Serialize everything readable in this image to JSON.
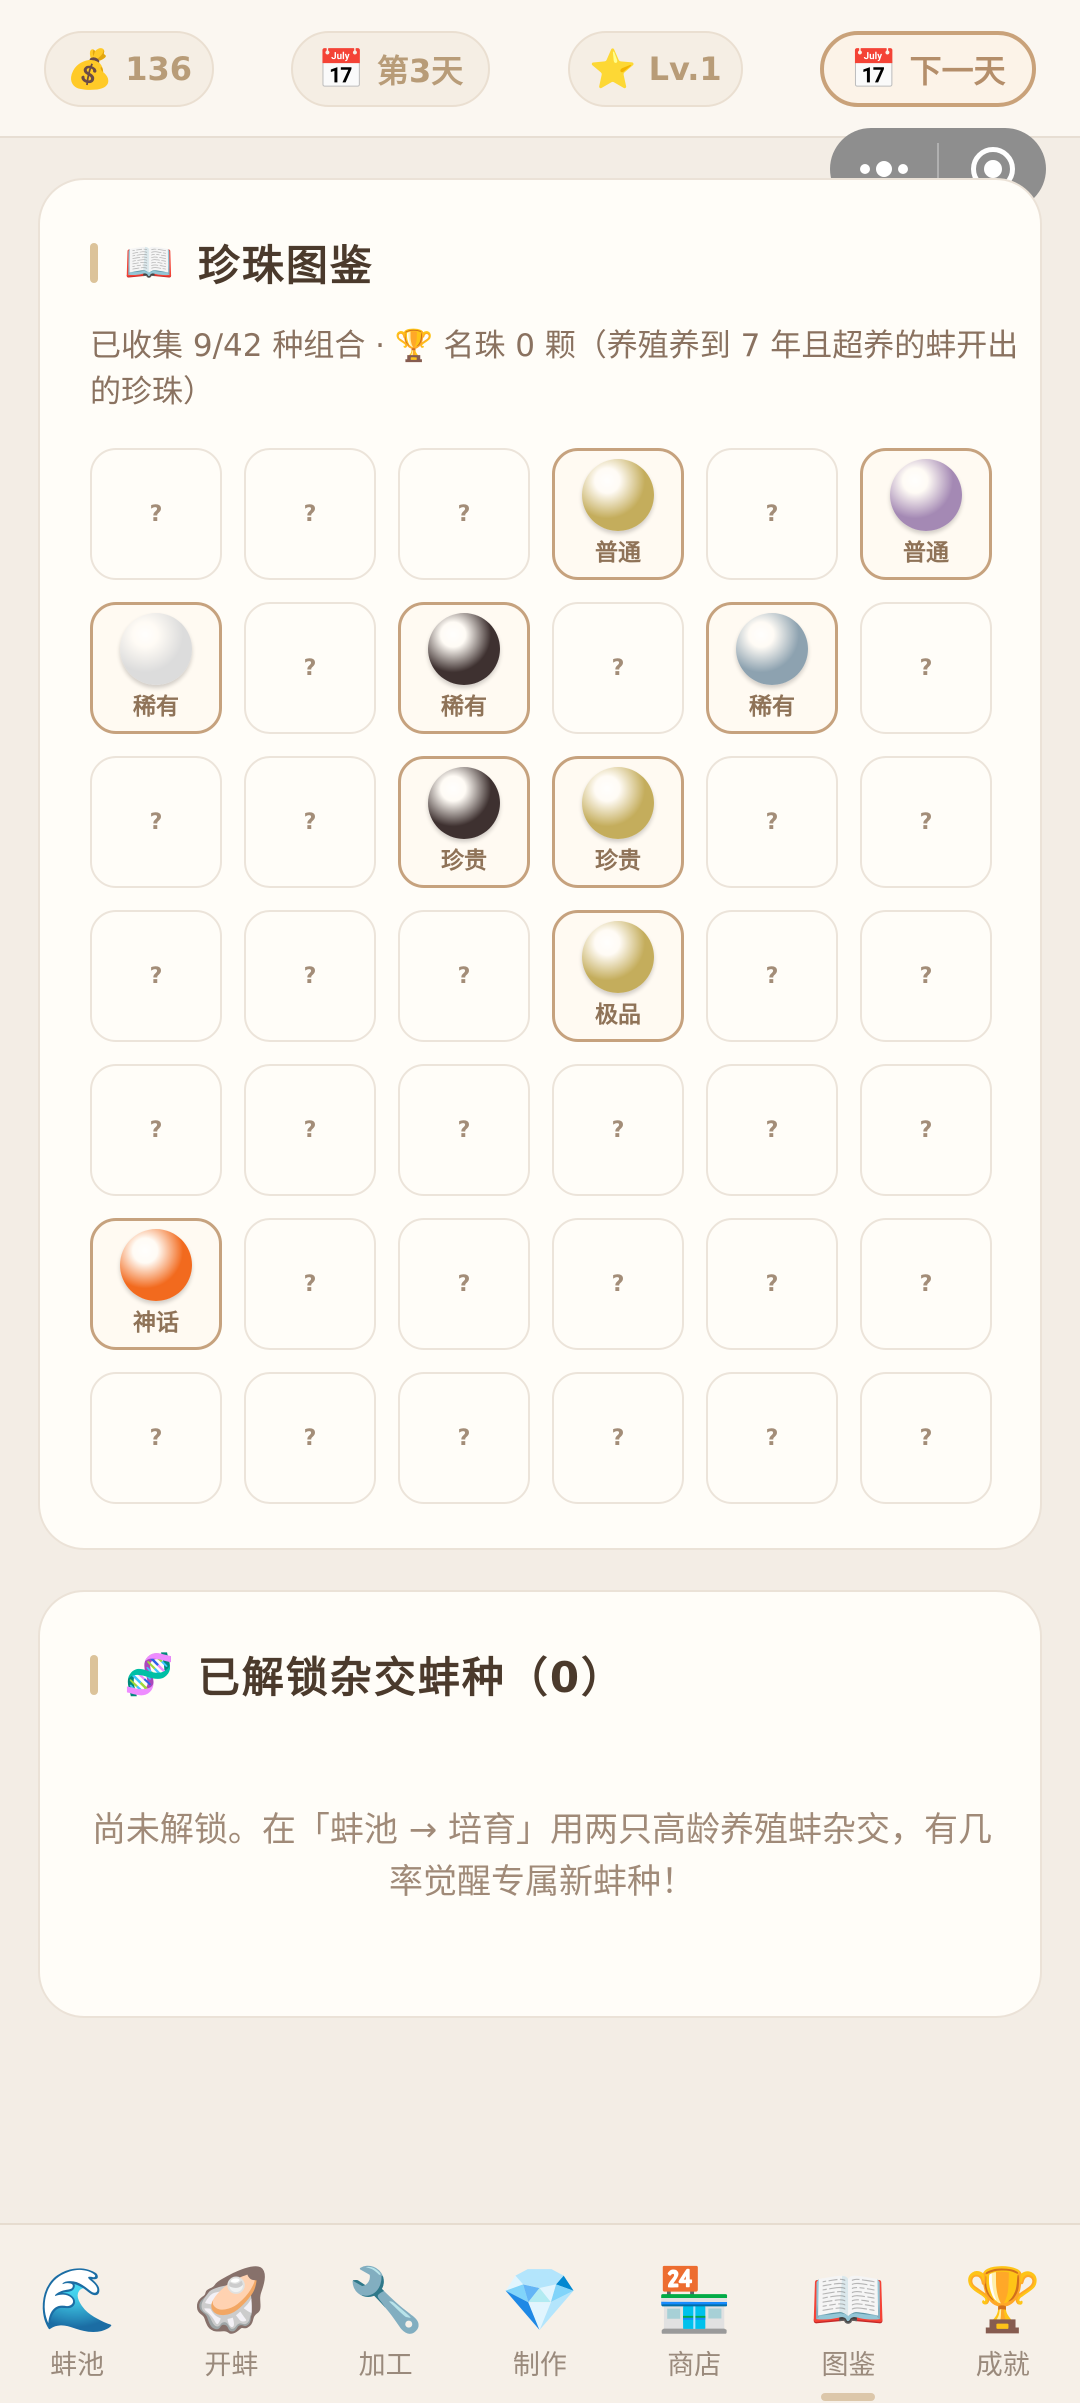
{
  "topbar": {
    "coins": {
      "icon": "💰",
      "value": "136"
    },
    "day": {
      "icon": "📅",
      "value": "第3天"
    },
    "level": {
      "icon": "⭐",
      "value": "Lv.1"
    },
    "next_day": {
      "icon": "📅",
      "label": "下一天"
    }
  },
  "pearl_book": {
    "icon": "📖",
    "title": "珍珠图鉴",
    "summary": "已收集 9/42 种组合 · 🏆 名珠 0 颗（养殖养到 7 年且超养的蚌开出的珍珠）",
    "unknown_mark": "?",
    "cells": [
      {
        "found": false
      },
      {
        "found": false
      },
      {
        "found": false
      },
      {
        "found": true,
        "label": "普通",
        "color": "#c4ad5c"
      },
      {
        "found": false
      },
      {
        "found": true,
        "label": "普通",
        "color": "#a489b4"
      },
      {
        "found": true,
        "label": "稀有",
        "color": "#dcdcdc"
      },
      {
        "found": false
      },
      {
        "found": true,
        "label": "稀有",
        "color": "#3e3130"
      },
      {
        "found": false
      },
      {
        "found": true,
        "label": "稀有",
        "color": "#8da2b0"
      },
      {
        "found": false
      },
      {
        "found": false
      },
      {
        "found": false
      },
      {
        "found": true,
        "label": "珍贵",
        "color": "#3e3130"
      },
      {
        "found": true,
        "label": "珍贵",
        "color": "#c4ad5c"
      },
      {
        "found": false
      },
      {
        "found": false
      },
      {
        "found": false
      },
      {
        "found": false
      },
      {
        "found": false
      },
      {
        "found": true,
        "label": "极品",
        "color": "#c4ad5c"
      },
      {
        "found": false
      },
      {
        "found": false
      },
      {
        "found": false
      },
      {
        "found": false
      },
      {
        "found": false
      },
      {
        "found": false
      },
      {
        "found": false
      },
      {
        "found": false
      },
      {
        "found": true,
        "label": "神话",
        "color": "#f26a1e"
      },
      {
        "found": false
      },
      {
        "found": false
      },
      {
        "found": false
      },
      {
        "found": false
      },
      {
        "found": false
      },
      {
        "found": false
      },
      {
        "found": false
      },
      {
        "found": false
      },
      {
        "found": false
      },
      {
        "found": false
      },
      {
        "found": false
      }
    ]
  },
  "hybrid": {
    "icon": "🧬",
    "title": "已解锁杂交蚌种（0）",
    "empty_message": "尚未解锁。在「蚌池 → 培育」用两只高龄养殖蚌杂交，有几率觉醒专属新蚌种！"
  },
  "bottom_nav": {
    "items": [
      {
        "icon": "🌊",
        "label": "蚌池",
        "name": "pond"
      },
      {
        "icon": "🦪",
        "label": "开蚌",
        "name": "open"
      },
      {
        "icon": "🔧",
        "label": "加工",
        "name": "process"
      },
      {
        "icon": "💎",
        "label": "制作",
        "name": "craft"
      },
      {
        "icon": "🏪",
        "label": "商店",
        "name": "shop"
      },
      {
        "icon": "📖",
        "label": "图鉴",
        "name": "book",
        "active": true
      },
      {
        "icon": "🏆",
        "label": "成就",
        "name": "achievements"
      }
    ]
  }
}
